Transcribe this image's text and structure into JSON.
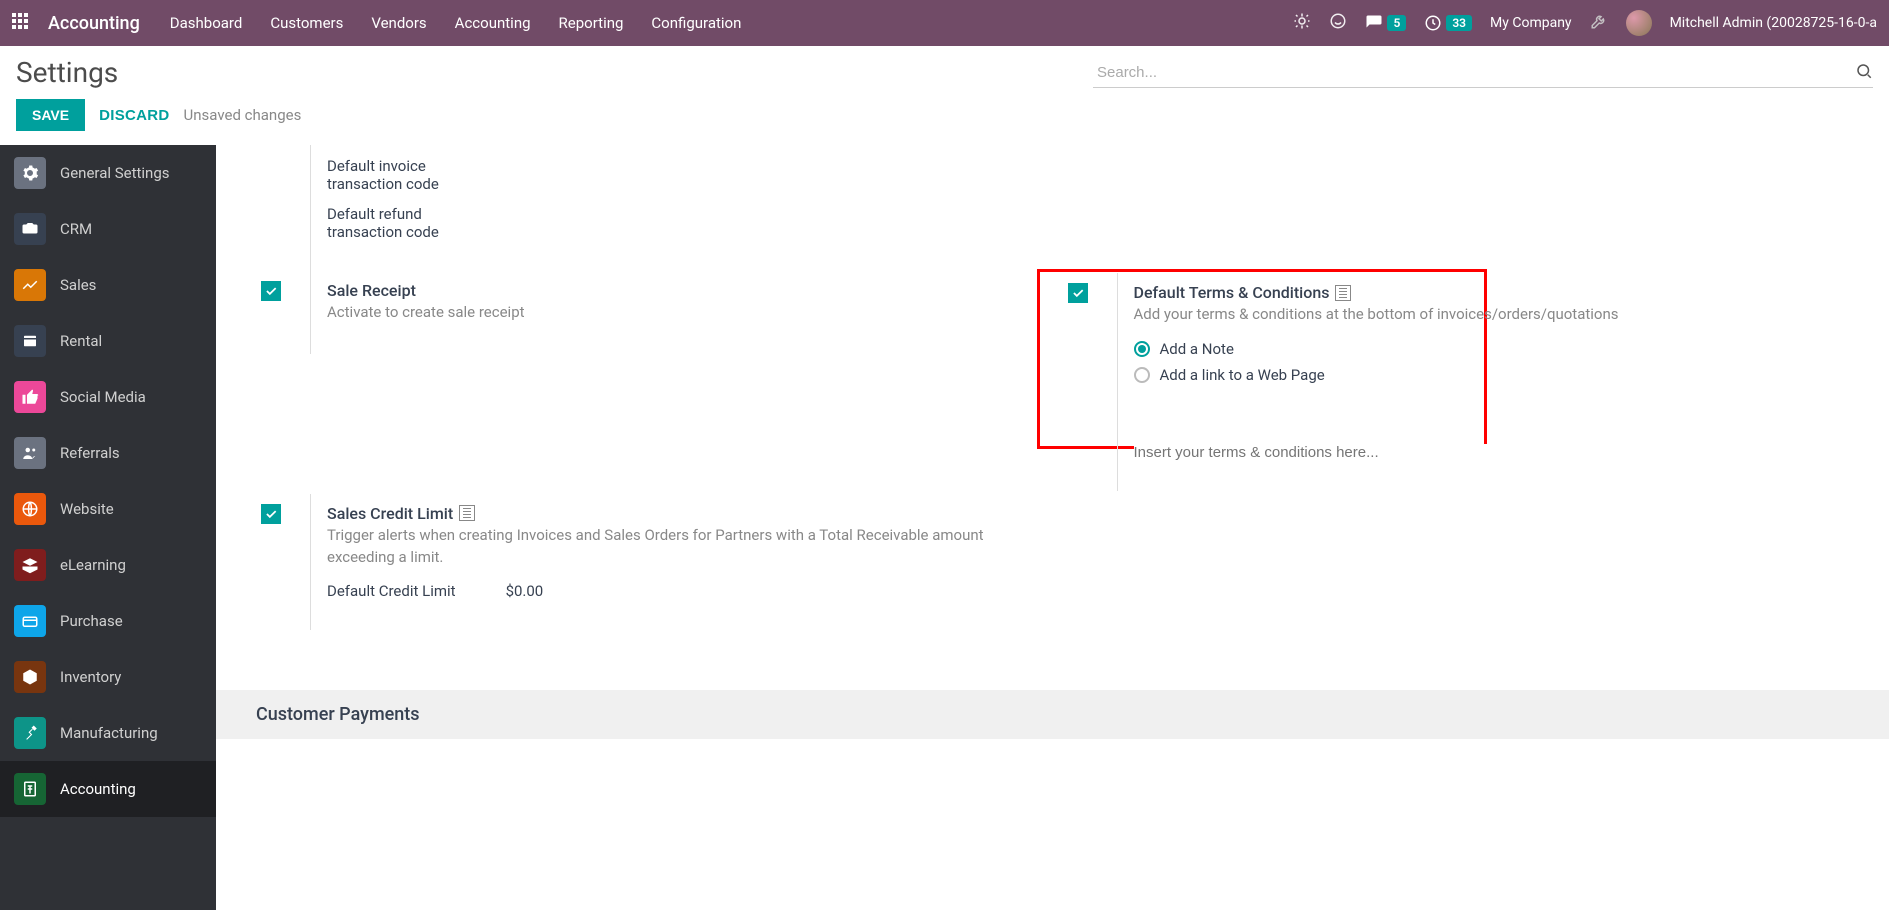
{
  "topnav": {
    "brand": "Accounting",
    "menu": [
      "Dashboard",
      "Customers",
      "Vendors",
      "Accounting",
      "Reporting",
      "Configuration"
    ],
    "msg_badge": "5",
    "activity_badge": "33",
    "company": "My Company",
    "user": "Mitchell Admin (20028725-16-0-a"
  },
  "header": {
    "title": "Settings",
    "search_placeholder": "Search...",
    "save": "SAVE",
    "discard": "DISCARD",
    "unsaved": "Unsaved changes"
  },
  "sidebar": {
    "items": [
      {
        "label": "General Settings",
        "color": "#6b7280"
      },
      {
        "label": "CRM",
        "color": "#374151"
      },
      {
        "label": "Sales",
        "color": "#d97706"
      },
      {
        "label": "Rental",
        "color": "#374151"
      },
      {
        "label": "Social Media",
        "color": "#ec4899"
      },
      {
        "label": "Referrals",
        "color": "#6b7280"
      },
      {
        "label": "Website",
        "color": "#ea580c"
      },
      {
        "label": "eLearning",
        "color": "#7f1d1d"
      },
      {
        "label": "Purchase",
        "color": "#0ea5e9"
      },
      {
        "label": "Inventory",
        "color": "#78350f"
      },
      {
        "label": "Manufacturing",
        "color": "#0d9488"
      },
      {
        "label": "Accounting",
        "color": "#166534"
      }
    ]
  },
  "settings": {
    "invoice_code": "Default invoice transaction code",
    "refund_code": "Default refund transaction code",
    "sale_receipt": {
      "title": "Sale Receipt",
      "desc": "Activate to create sale receipt"
    },
    "terms": {
      "title": "Default Terms & Conditions",
      "desc": "Add your terms & conditions at the bottom of invoices/orders/quotations",
      "opt1": "Add a Note",
      "opt2": "Add a link to a Web Page",
      "placeholder": "Insert your terms & conditions here..."
    },
    "credit_limit": {
      "title": "Sales Credit Limit",
      "desc": "Trigger alerts when creating Invoices and Sales Orders for Partners with a Total Receivable amount exceeding a limit.",
      "field": "Default Credit Limit",
      "value": "$0.00"
    },
    "section": "Customer Payments"
  }
}
